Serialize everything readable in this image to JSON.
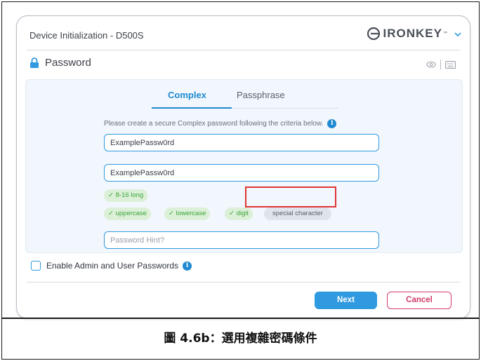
{
  "window": {
    "title": "Device Initialization - D500S",
    "brand": "IRONKEY",
    "brand_tm": "™"
  },
  "section": {
    "title": "Password"
  },
  "tabs": [
    {
      "label": "Complex",
      "active": true
    },
    {
      "label": "Passphrase",
      "active": false
    }
  ],
  "instruction": "Please create a secure Complex password following the criteria below.",
  "fields": {
    "password": {
      "value": "ExamplePassw0rd"
    },
    "confirm": {
      "value": "ExamplePassw0rd"
    },
    "hint": {
      "placeholder": "Password Hint?"
    }
  },
  "criteria": {
    "length": "✓ 8-16 long",
    "uppercase": "✓ uppercase",
    "lowercase": "✓ lowercase",
    "digit": "✓ digit",
    "special": "special character"
  },
  "admin": {
    "label": "Enable Admin and User Passwords"
  },
  "buttons": {
    "next": "Next",
    "cancel": "Cancel"
  },
  "caption": "圖 4.6b：選用複雜密碼條件",
  "colors": {
    "accent": "#2f9ae0",
    "cancel": "#d23b6a",
    "ok_chip": "#dcf0d8",
    "highlight": "#e03434"
  }
}
